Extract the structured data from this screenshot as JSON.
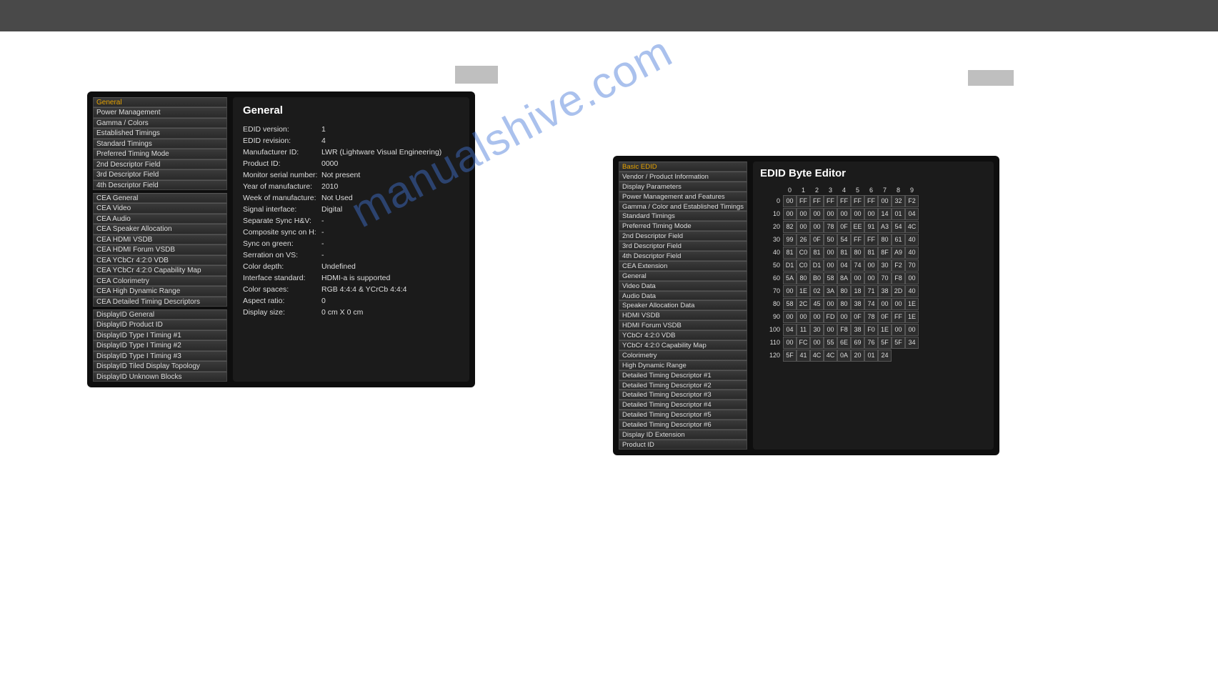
{
  "left": {
    "nav_group1": [
      "General",
      "Power Management",
      "Gamma / Colors",
      "Established Timings",
      "Standard Timings",
      "Preferred Timing Mode",
      "2nd Descriptor Field",
      "3rd Descriptor Field",
      "4th Descriptor Field"
    ],
    "nav_group2": [
      "CEA General",
      "CEA Video",
      "CEA Audio",
      "CEA Speaker Allocation",
      "CEA HDMI VSDB",
      "CEA HDMI Forum VSDB",
      "CEA YCbCr 4:2:0 VDB",
      "CEA YCbCr 4:2:0 Capability Map",
      "CEA Colorimetry",
      "CEA High Dynamic Range",
      "CEA Detailed Timing Descriptors"
    ],
    "nav_group3": [
      "DisplayID General",
      "DisplayID Product ID",
      "DisplayID Type I Timing #1",
      "DisplayID Type I Timing #2",
      "DisplayID Type I Timing #3",
      "DisplayID Tiled Display Topology",
      "DisplayID Unknown Blocks"
    ],
    "title": "General",
    "rows": [
      {
        "k": "EDID version:",
        "v": "1"
      },
      {
        "k": "EDID revision:",
        "v": "4"
      },
      {
        "k": "Manufacturer ID:",
        "v": "LWR (Lightware Visual Engineering)"
      },
      {
        "k": "Product ID:",
        "v": "0000"
      },
      {
        "k": "Monitor serial number:",
        "v": "Not present"
      },
      {
        "k": "Year of manufacture:",
        "v": "2010"
      },
      {
        "k": "Week of manufacture:",
        "v": "Not Used"
      },
      {
        "k": "Signal interface:",
        "v": "Digital"
      },
      {
        "k": "Separate Sync H&V:",
        "v": "-"
      },
      {
        "k": "Composite sync on H:",
        "v": "-"
      },
      {
        "k": "Sync on green:",
        "v": "-"
      },
      {
        "k": "Serration on VS:",
        "v": "-"
      },
      {
        "k": "Color depth:",
        "v": "Undefined"
      },
      {
        "k": "Interface standard:",
        "v": "HDMI-a is supported"
      },
      {
        "k": "Color spaces:",
        "v": "RGB 4:4:4 & YCrCb 4:4:4"
      },
      {
        "k": "Aspect ratio:",
        "v": "0"
      },
      {
        "k": "Display size:",
        "v": "0 cm X 0 cm"
      }
    ]
  },
  "right": {
    "nav_group1": [
      "Basic EDID",
      "Vendor / Product Information",
      "Display Parameters",
      "Power Management and Features",
      "Gamma / Color and Established Timings",
      "Standard Timings",
      "Preferred Timing Mode",
      "2nd Descriptor Field",
      "3rd Descriptor Field",
      "4th Descriptor Field"
    ],
    "nav_group2": [
      "CEA Extension",
      "General",
      "Video Data",
      "Audio Data",
      "Speaker Allocation Data",
      "HDMI VSDB",
      "HDMI Forum VSDB",
      "YCbCr 4:2:0 VDB",
      "YCbCr 4:2:0 Capability Map",
      "Colorimetry",
      "High Dynamic Range",
      "Detailed Timing Descriptor #1",
      "Detailed Timing Descriptor #2",
      "Detailed Timing Descriptor #3",
      "Detailed Timing Descriptor #4",
      "Detailed Timing Descriptor #5",
      "Detailed Timing Descriptor #6"
    ],
    "nav_group3": [
      "Display ID Extension",
      "Product ID"
    ],
    "title": "EDID Byte Editor",
    "columns": [
      "0",
      "1",
      "2",
      "3",
      "4",
      "5",
      "6",
      "7",
      "8",
      "9"
    ],
    "rows": [
      {
        "label": "0",
        "cells": [
          "00",
          "FF",
          "FF",
          "FF",
          "FF",
          "FF",
          "FF",
          "00",
          "32",
          "F2"
        ]
      },
      {
        "label": "10",
        "cells": [
          "00",
          "00",
          "00",
          "00",
          "00",
          "00",
          "00",
          "14",
          "01",
          "04"
        ]
      },
      {
        "label": "20",
        "cells": [
          "82",
          "00",
          "00",
          "78",
          "0F",
          "EE",
          "91",
          "A3",
          "54",
          "4C"
        ]
      },
      {
        "label": "30",
        "cells": [
          "99",
          "26",
          "0F",
          "50",
          "54",
          "FF",
          "FF",
          "80",
          "61",
          "40"
        ]
      },
      {
        "label": "40",
        "cells": [
          "81",
          "C0",
          "81",
          "00",
          "81",
          "80",
          "81",
          "8F",
          "A9",
          "40"
        ]
      },
      {
        "label": "50",
        "cells": [
          "D1",
          "C0",
          "D1",
          "00",
          "04",
          "74",
          "00",
          "30",
          "F2",
          "70"
        ]
      },
      {
        "label": "60",
        "cells": [
          "5A",
          "80",
          "B0",
          "58",
          "8A",
          "00",
          "00",
          "70",
          "F8",
          "00"
        ]
      },
      {
        "label": "70",
        "cells": [
          "00",
          "1E",
          "02",
          "3A",
          "80",
          "18",
          "71",
          "38",
          "2D",
          "40"
        ]
      },
      {
        "label": "80",
        "cells": [
          "58",
          "2C",
          "45",
          "00",
          "80",
          "38",
          "74",
          "00",
          "00",
          "1E"
        ]
      },
      {
        "label": "90",
        "cells": [
          "00",
          "00",
          "00",
          "FD",
          "00",
          "0F",
          "78",
          "0F",
          "FF",
          "1E"
        ]
      },
      {
        "label": "100",
        "cells": [
          "04",
          "11",
          "30",
          "00",
          "F8",
          "38",
          "F0",
          "1E",
          "00",
          "00"
        ]
      },
      {
        "label": "110",
        "cells": [
          "00",
          "FC",
          "00",
          "55",
          "6E",
          "69",
          "76",
          "5F",
          "5F",
          "34"
        ]
      },
      {
        "label": "120",
        "cells": [
          "5F",
          "41",
          "4C",
          "4C",
          "0A",
          "20",
          "01",
          "24",
          "",
          ""
        ]
      }
    ]
  },
  "watermark": "manualshive.com"
}
